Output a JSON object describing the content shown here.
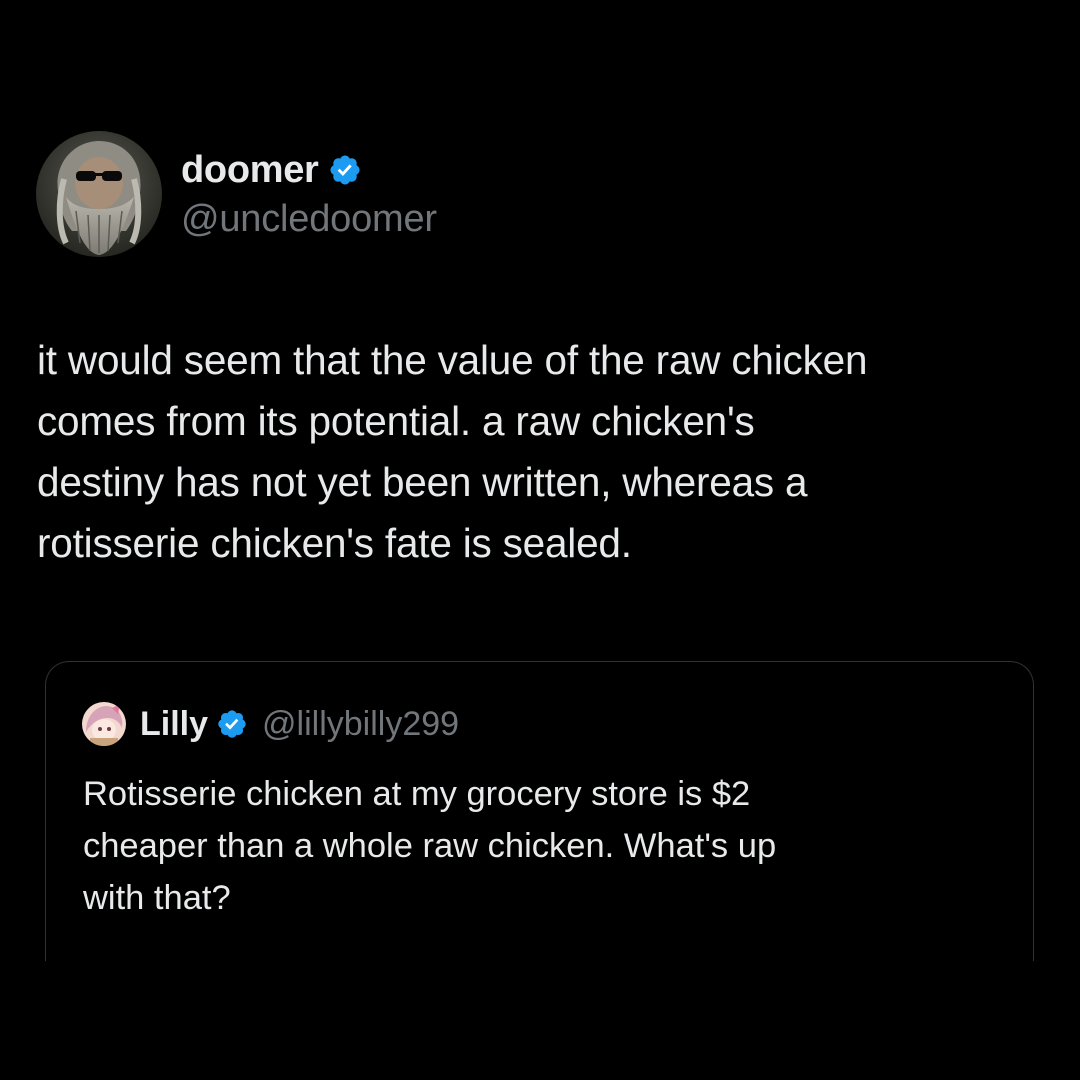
{
  "tweet": {
    "author": {
      "display_name": "doomer",
      "handle": "@uncledoomer",
      "verified_icon": "verified-badge-icon",
      "avatar": "avatar-bearded-man-sunglasses"
    },
    "text_lines": [
      "it would seem that the value of the raw chicken",
      "comes from its potential. a raw chicken's",
      "destiny has not yet been written, whereas a",
      "rotisserie chicken's fate is sealed."
    ]
  },
  "quoted_tweet": {
    "author": {
      "display_name": "Lilly",
      "handle": "@lillybilly299",
      "verified_icon": "verified-badge-icon",
      "avatar": "avatar-anime-character"
    },
    "text_lines": [
      "Rotisserie chicken at my grocery store is $2",
      "cheaper than a whole raw chicken. What's up",
      "with that?"
    ]
  },
  "colors": {
    "background": "#000000",
    "primary_text": "#e7e9ea",
    "secondary_text": "#71767b",
    "verified_blue": "#1d9bf0",
    "card_border": "#2f3336"
  }
}
